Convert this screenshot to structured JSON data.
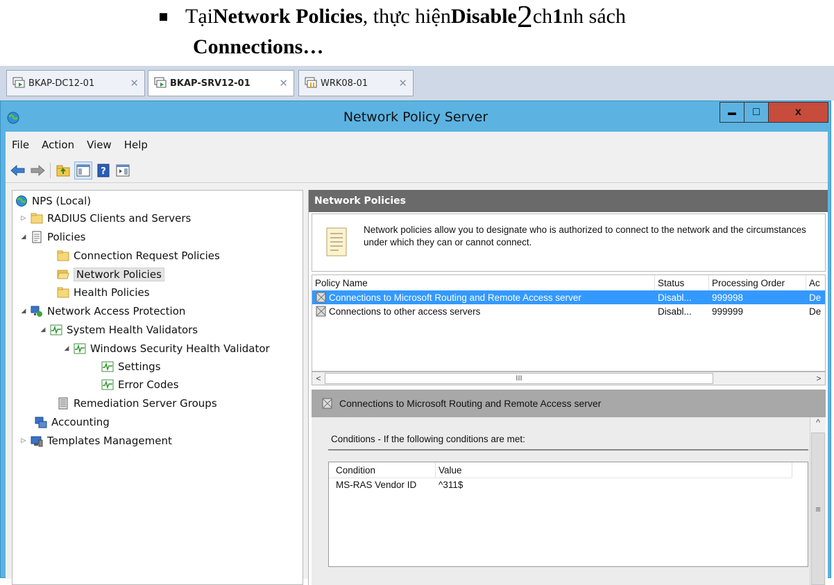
{
  "doc": {
    "bullet": "▪",
    "line1_a": "Tại ",
    "line1_b": "Network Policies",
    "line1_c": " , thực hiện ",
    "line1_d": "Disable",
    "line1_e": " ",
    "line1_big": "2",
    "line1_f": "ch",
    "line1_g": "1",
    "line1_h": "nh sách",
    "line2": "Connections…"
  },
  "tabs": [
    {
      "label": "BKAP-DC12-01",
      "close": "✕"
    },
    {
      "label": "BKAP-SRV12-01",
      "close": "✕"
    },
    {
      "label": "WRK08-01",
      "close": "✕"
    }
  ],
  "window": {
    "title": "Network Policy Server",
    "min_symbol": "▬",
    "max_symbol": "□",
    "close_symbol": "x"
  },
  "menu": [
    "File",
    "Action",
    "View",
    "Help"
  ],
  "toolbar_icons": [
    "back-arrow-icon",
    "forward-arrow-icon",
    "up-folder-icon",
    "show-hide-tree-icon",
    "help-icon",
    "action-pane-icon"
  ],
  "tree": [
    {
      "label": "NPS (Local)",
      "icon": "nps-icon",
      "expand": ""
    },
    {
      "label": "RADIUS Clients and Servers",
      "icon": "folder-icon",
      "expand": "▷"
    },
    {
      "label": "Policies",
      "icon": "policy-icon",
      "expand": "◢"
    },
    {
      "label": "Connection Request Policies",
      "icon": "folder-icon",
      "expand": ""
    },
    {
      "label": "Network Policies",
      "icon": "folder-open-icon",
      "expand": ""
    },
    {
      "label": "Health Policies",
      "icon": "folder-icon",
      "expand": ""
    },
    {
      "label": "Network Access Protection",
      "icon": "nap-icon",
      "expand": "◢"
    },
    {
      "label": "System Health Validators",
      "icon": "validator-icon",
      "expand": "◢"
    },
    {
      "label": "Windows Security Health Validator",
      "icon": "validator-icon",
      "expand": "◢"
    },
    {
      "label": "Settings",
      "icon": "validator-icon",
      "expand": ""
    },
    {
      "label": "Error Codes",
      "icon": "validator-icon",
      "expand": ""
    },
    {
      "label": "Remediation Server Groups",
      "icon": "server-group-icon",
      "expand": ""
    },
    {
      "label": "Accounting",
      "icon": "accounting-icon",
      "expand": ""
    },
    {
      "label": "Templates Management",
      "icon": "templates-icon",
      "expand": "▷"
    }
  ],
  "right": {
    "header": "Network Policies",
    "info": "Network policies allow you to designate who is authorized to connect to the network and the circumstances under which they can or cannot connect.",
    "columns": [
      "Policy Name",
      "Status",
      "Processing Order",
      "Ac"
    ],
    "rows": [
      {
        "name": "Connections to Microsoft Routing and Remote Access server",
        "status": "Disabl...",
        "order": "999998",
        "access": "De"
      },
      {
        "name": "Connections to other access servers",
        "status": "Disabl...",
        "order": "999999",
        "access": "De"
      }
    ],
    "scroll_left": "<",
    "scroll_right": ">",
    "scroll_mid": "III",
    "detail_title": "Connections to Microsoft Routing and Remote Access server",
    "conditions_label": "Conditions - If the following conditions are met:",
    "cond_columns": [
      "Condition",
      "Value"
    ],
    "cond_rows": [
      {
        "condition": "MS-RAS Vendor ID",
        "value": "^311$"
      }
    ],
    "vscroll_up": "^",
    "vscroll_mid": "≡"
  }
}
